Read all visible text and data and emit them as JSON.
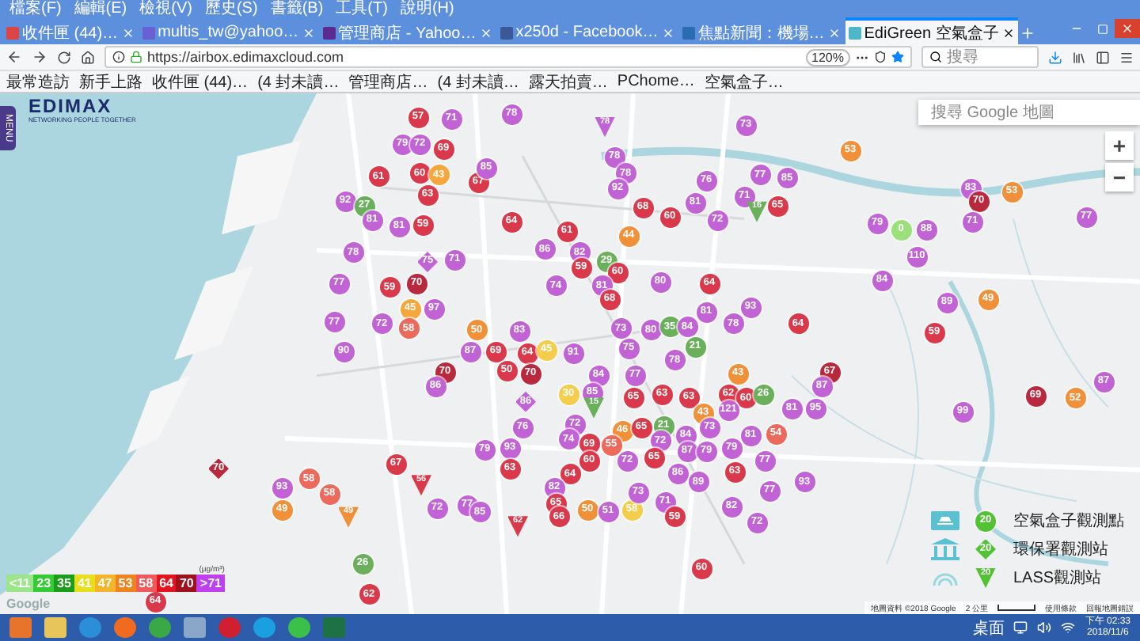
{
  "menu_bar": [
    "檔案(F)",
    "編輯(E)",
    "檢視(V)",
    "歷史(S)",
    "書籤(B)",
    "工具(T)",
    "說明(H)"
  ],
  "tabs": [
    {
      "title": "收件匣 (44)…",
      "selected": false
    },
    {
      "title": "multis_tw@yahoo…",
      "selected": false
    },
    {
      "title": "管理商店 - Yahoo…",
      "selected": false
    },
    {
      "title": "x250d - Facebook…",
      "selected": false
    },
    {
      "title": "焦點新聞：機場…",
      "selected": false
    },
    {
      "title": "EdiGreen 空氣盒子",
      "selected": true
    }
  ],
  "address_bar": {
    "url": "https://airbox.edimaxcloud.com",
    "zoom": "120%"
  },
  "search_bar": {
    "placeholder": "搜尋"
  },
  "bookmarks": [
    "最常造訪",
    "新手上路",
    "收件匣 (44)…",
    "(4 封未讀…",
    "管理商店…",
    "(4 封未讀…",
    "露天拍賣…",
    "PChome…",
    "空氣盒子…"
  ],
  "page": {
    "logo": "EDIMAX",
    "logo_tagline": "NETWORKING PEOPLE TOGETHER",
    "menu_button": "MENU",
    "map_search": {
      "placeholder": "搜尋 Google 地圖"
    },
    "zoom_in": "+",
    "zoom_out": "−"
  },
  "markers": [
    {
      "value": "57",
      "color": "#d9394a",
      "kind": "circle"
    },
    {
      "value": "71",
      "color": "#c163d4",
      "kind": "circle"
    },
    {
      "value": "78",
      "color": "#c163d4",
      "kind": "circle"
    },
    {
      "value": "79",
      "color": "#c163d4",
      "kind": "circle"
    },
    {
      "value": "72",
      "color": "#c163d4",
      "kind": "circle"
    },
    {
      "value": "69",
      "color": "#d9394a",
      "kind": "circle"
    },
    {
      "value": "61",
      "color": "#d9394a",
      "kind": "circle"
    },
    {
      "value": "60",
      "color": "#d9394a",
      "kind": "circle"
    },
    {
      "value": "43",
      "color": "#f5a73c",
      "kind": "circle"
    },
    {
      "value": "67",
      "color": "#d9394a",
      "kind": "circle"
    },
    {
      "value": "85",
      "color": "#c163d4",
      "kind": "circle"
    },
    {
      "value": "92",
      "color": "#c163d4",
      "kind": "circle"
    },
    {
      "value": "27",
      "color": "#6aaf5a",
      "kind": "circle"
    },
    {
      "value": "63",
      "color": "#d9394a",
      "kind": "circle"
    },
    {
      "value": "81",
      "color": "#c163d4",
      "kind": "circle"
    },
    {
      "value": "81",
      "color": "#c163d4",
      "kind": "circle"
    },
    {
      "value": "59",
      "color": "#d9394a",
      "kind": "circle"
    },
    {
      "value": "78",
      "color": "#c163d4",
      "kind": "circle"
    },
    {
      "value": "75",
      "color": "#c163d4",
      "kind": "diamond"
    },
    {
      "value": "71",
      "color": "#c163d4",
      "kind": "circle"
    },
    {
      "value": "77",
      "color": "#c163d4",
      "kind": "circle"
    },
    {
      "value": "59",
      "color": "#d9394a",
      "kind": "circle"
    },
    {
      "value": "70",
      "color": "#b8293d",
      "kind": "circle"
    },
    {
      "value": "45",
      "color": "#f5a73c",
      "kind": "circle"
    },
    {
      "value": "97",
      "color": "#c163d4",
      "kind": "circle"
    },
    {
      "value": "77",
      "color": "#c163d4",
      "kind": "circle"
    },
    {
      "value": "72",
      "color": "#c163d4",
      "kind": "circle"
    },
    {
      "value": "58",
      "color": "#ec6a5c",
      "kind": "circle"
    },
    {
      "value": "90",
      "color": "#c163d4",
      "kind": "circle"
    },
    {
      "value": "70",
      "color": "#b8293d",
      "kind": "circle"
    },
    {
      "value": "86",
      "color": "#c163d4",
      "kind": "circle"
    },
    {
      "value": "78",
      "color": "#c163d4",
      "kind": "triangle"
    },
    {
      "value": "73",
      "color": "#c163d4",
      "kind": "circle"
    },
    {
      "value": "78",
      "color": "#c163d4",
      "kind": "circle"
    },
    {
      "value": "78",
      "color": "#c163d4",
      "kind": "circle"
    },
    {
      "value": "92",
      "color": "#c163d4",
      "kind": "circle"
    },
    {
      "value": "76",
      "color": "#c163d4",
      "kind": "circle"
    },
    {
      "value": "77",
      "color": "#c163d4",
      "kind": "circle"
    },
    {
      "value": "85",
      "color": "#c163d4",
      "kind": "circle"
    },
    {
      "value": "68",
      "color": "#d9394a",
      "kind": "circle"
    },
    {
      "value": "60",
      "color": "#d9394a",
      "kind": "circle"
    },
    {
      "value": "81",
      "color": "#c163d4",
      "kind": "circle"
    },
    {
      "value": "72",
      "color": "#c163d4",
      "kind": "circle"
    },
    {
      "value": "71",
      "color": "#c163d4",
      "kind": "circle"
    },
    {
      "value": "16",
      "color": "#6aaf5a",
      "kind": "triangle"
    },
    {
      "value": "65",
      "color": "#d9394a",
      "kind": "circle"
    },
    {
      "value": "53",
      "color": "#f0913a",
      "kind": "circle"
    },
    {
      "value": "83",
      "color": "#c163d4",
      "kind": "circle"
    },
    {
      "value": "70",
      "color": "#b8293d",
      "kind": "circle"
    },
    {
      "value": "53",
      "color": "#f0913a",
      "kind": "circle"
    },
    {
      "value": "79",
      "color": "#c163d4",
      "kind": "circle"
    },
    {
      "value": "0",
      "color": "#9be07a",
      "kind": "circle"
    },
    {
      "value": "88",
      "color": "#c163d4",
      "kind": "circle"
    },
    {
      "value": "71",
      "color": "#c163d4",
      "kind": "circle"
    },
    {
      "value": "77",
      "color": "#c163d4",
      "kind": "circle"
    },
    {
      "value": "110",
      "color": "#c163d4",
      "kind": "circle"
    },
    {
      "value": "84",
      "color": "#c163d4",
      "kind": "circle"
    },
    {
      "value": "89",
      "color": "#c163d4",
      "kind": "circle"
    },
    {
      "value": "49",
      "color": "#f0913a",
      "kind": "circle"
    },
    {
      "value": "64",
      "color": "#d9394a",
      "kind": "circle"
    },
    {
      "value": "59",
      "color": "#d9394a",
      "kind": "circle"
    },
    {
      "value": "67",
      "color": "#b8293d",
      "kind": "circle"
    },
    {
      "value": "87",
      "color": "#c163d4",
      "kind": "circle"
    },
    {
      "value": "69",
      "color": "#b8293d",
      "kind": "circle"
    },
    {
      "value": "52",
      "color": "#f0913a",
      "kind": "circle"
    },
    {
      "value": "87",
      "color": "#c163d4",
      "kind": "circle"
    },
    {
      "value": "99",
      "color": "#c163d4",
      "kind": "circle"
    },
    {
      "value": "81",
      "color": "#c163d4",
      "kind": "circle"
    },
    {
      "value": "95",
      "color": "#c163d4",
      "kind": "circle"
    },
    {
      "value": "64",
      "color": "#d9394a",
      "kind": "circle"
    },
    {
      "value": "61",
      "color": "#d9394a",
      "kind": "circle"
    },
    {
      "value": "86",
      "color": "#c163d4",
      "kind": "circle"
    },
    {
      "value": "82",
      "color": "#c163d4",
      "kind": "circle"
    },
    {
      "value": "44",
      "color": "#f0913a",
      "kind": "circle"
    },
    {
      "value": "29",
      "color": "#6aaf5a",
      "kind": "circle"
    },
    {
      "value": "59",
      "color": "#d9394a",
      "kind": "circle"
    },
    {
      "value": "60",
      "color": "#d9394a",
      "kind": "circle"
    },
    {
      "value": "74",
      "color": "#c163d4",
      "kind": "circle"
    },
    {
      "value": "81",
      "color": "#c163d4",
      "kind": "circle"
    },
    {
      "value": "68",
      "color": "#d9394a",
      "kind": "circle"
    },
    {
      "value": "80",
      "color": "#c163d4",
      "kind": "circle"
    },
    {
      "value": "64",
      "color": "#d9394a",
      "kind": "circle"
    },
    {
      "value": "81",
      "color": "#c163d4",
      "kind": "circle"
    },
    {
      "value": "93",
      "color": "#c163d4",
      "kind": "circle"
    },
    {
      "value": "73",
      "color": "#c163d4",
      "kind": "circle"
    },
    {
      "value": "80",
      "color": "#c163d4",
      "kind": "circle"
    },
    {
      "value": "35",
      "color": "#6aaf5a",
      "kind": "circle"
    },
    {
      "value": "84",
      "color": "#c163d4",
      "kind": "circle"
    },
    {
      "value": "78",
      "color": "#c163d4",
      "kind": "circle"
    },
    {
      "value": "75",
      "color": "#c163d4",
      "kind": "circle"
    },
    {
      "value": "78",
      "color": "#c163d4",
      "kind": "circle"
    },
    {
      "value": "21",
      "color": "#6aaf5a",
      "kind": "circle"
    },
    {
      "value": "77",
      "color": "#c163d4",
      "kind": "circle"
    },
    {
      "value": "43",
      "color": "#f0913a",
      "kind": "circle"
    },
    {
      "value": "65",
      "color": "#d9394a",
      "kind": "circle"
    },
    {
      "value": "63",
      "color": "#d9394a",
      "kind": "circle"
    },
    {
      "value": "63",
      "color": "#d9394a",
      "kind": "circle"
    },
    {
      "value": "62",
      "color": "#d9394a",
      "kind": "circle"
    },
    {
      "value": "60",
      "color": "#d9394a",
      "kind": "circle"
    },
    {
      "value": "26",
      "color": "#6aaf5a",
      "kind": "circle"
    },
    {
      "value": "43",
      "color": "#f0913a",
      "kind": "circle"
    },
    {
      "value": "121",
      "color": "#c163d4",
      "kind": "circle"
    },
    {
      "value": "50",
      "color": "#f0913a",
      "kind": "circle"
    },
    {
      "value": "83",
      "color": "#c163d4",
      "kind": "circle"
    },
    {
      "value": "87",
      "color": "#c163d4",
      "kind": "circle"
    },
    {
      "value": "69",
      "color": "#d9394a",
      "kind": "circle"
    },
    {
      "value": "64",
      "color": "#d9394a",
      "kind": "circle"
    },
    {
      "value": "45",
      "color": "#f3cd4b",
      "kind": "circle"
    },
    {
      "value": "91",
      "color": "#c163d4",
      "kind": "circle"
    },
    {
      "value": "50",
      "color": "#d9394a",
      "kind": "circle"
    },
    {
      "value": "70",
      "color": "#b8293d",
      "kind": "circle"
    },
    {
      "value": "84",
      "color": "#c163d4",
      "kind": "circle"
    },
    {
      "value": "86",
      "color": "#c163d4",
      "kind": "diamond"
    },
    {
      "value": "30",
      "color": "#f3cd4b",
      "kind": "circle"
    },
    {
      "value": "85",
      "color": "#c163d4",
      "kind": "circle"
    },
    {
      "value": "15",
      "color": "#6aaf5a",
      "kind": "triangle"
    },
    {
      "value": "76",
      "color": "#c163d4",
      "kind": "circle"
    },
    {
      "value": "72",
      "color": "#c163d4",
      "kind": "circle"
    },
    {
      "value": "46",
      "color": "#f0913a",
      "kind": "circle"
    },
    {
      "value": "65",
      "color": "#d9394a",
      "kind": "circle"
    },
    {
      "value": "21",
      "color": "#6aaf5a",
      "kind": "circle"
    },
    {
      "value": "84",
      "color": "#c163d4",
      "kind": "circle"
    },
    {
      "value": "73",
      "color": "#c163d4",
      "kind": "circle"
    },
    {
      "value": "81",
      "color": "#c163d4",
      "kind": "circle"
    },
    {
      "value": "54",
      "color": "#ec6a5c",
      "kind": "circle"
    },
    {
      "value": "79",
      "color": "#c163d4",
      "kind": "circle"
    },
    {
      "value": "93",
      "color": "#c163d4",
      "kind": "circle"
    },
    {
      "value": "74",
      "color": "#c163d4",
      "kind": "circle"
    },
    {
      "value": "69",
      "color": "#d9394a",
      "kind": "circle"
    },
    {
      "value": "55",
      "color": "#ec6a5c",
      "kind": "circle"
    },
    {
      "value": "72",
      "color": "#c163d4",
      "kind": "circle"
    },
    {
      "value": "87",
      "color": "#c163d4",
      "kind": "circle"
    },
    {
      "value": "79",
      "color": "#c163d4",
      "kind": "circle"
    },
    {
      "value": "79",
      "color": "#c163d4",
      "kind": "circle"
    },
    {
      "value": "70",
      "color": "#b8293d",
      "kind": "diamond"
    },
    {
      "value": "67",
      "color": "#d9394a",
      "kind": "circle"
    },
    {
      "value": "63",
      "color": "#d9394a",
      "kind": "circle"
    },
    {
      "value": "64",
      "color": "#d9394a",
      "kind": "circle"
    },
    {
      "value": "60",
      "color": "#d9394a",
      "kind": "circle"
    },
    {
      "value": "72",
      "color": "#c163d4",
      "kind": "circle"
    },
    {
      "value": "65",
      "color": "#d9394a",
      "kind": "circle"
    },
    {
      "value": "86",
      "color": "#c163d4",
      "kind": "circle"
    },
    {
      "value": "89",
      "color": "#c163d4",
      "kind": "circle"
    },
    {
      "value": "63",
      "color": "#d9394a",
      "kind": "circle"
    },
    {
      "value": "77",
      "color": "#c163d4",
      "kind": "circle"
    },
    {
      "value": "93",
      "color": "#c163d4",
      "kind": "circle"
    },
    {
      "value": "58",
      "color": "#ec6a5c",
      "kind": "circle"
    },
    {
      "value": "58",
      "color": "#ec6a5c",
      "kind": "circle"
    },
    {
      "value": "56",
      "color": "#d9394a",
      "kind": "triangle"
    },
    {
      "value": "49",
      "color": "#f0913a",
      "kind": "circle"
    },
    {
      "value": "49",
      "color": "#f0913a",
      "kind": "triangle"
    },
    {
      "value": "72",
      "color": "#c163d4",
      "kind": "circle"
    },
    {
      "value": "77",
      "color": "#c163d4",
      "kind": "circle"
    },
    {
      "value": "85",
      "color": "#c163d4",
      "kind": "circle"
    },
    {
      "value": "62",
      "color": "#d9394a",
      "kind": "triangle"
    },
    {
      "value": "82",
      "color": "#c163d4",
      "kind": "circle"
    },
    {
      "value": "65",
      "color": "#d9394a",
      "kind": "circle"
    },
    {
      "value": "66",
      "color": "#d9394a",
      "kind": "circle"
    },
    {
      "value": "50",
      "color": "#f0913a",
      "kind": "circle"
    },
    {
      "value": "51",
      "color": "#c163d4",
      "kind": "circle"
    },
    {
      "value": "58",
      "color": "#f3cd4b",
      "kind": "circle"
    },
    {
      "value": "73",
      "color": "#c163d4",
      "kind": "circle"
    },
    {
      "value": "71",
      "color": "#c163d4",
      "kind": "circle"
    },
    {
      "value": "59",
      "color": "#d9394a",
      "kind": "circle"
    },
    {
      "value": "82",
      "color": "#c163d4",
      "kind": "circle"
    },
    {
      "value": "72",
      "color": "#c163d4",
      "kind": "circle"
    },
    {
      "value": "77",
      "color": "#c163d4",
      "kind": "circle"
    },
    {
      "value": "93",
      "color": "#c163d4",
      "kind": "circle"
    },
    {
      "value": "26",
      "color": "#6aaf5a",
      "kind": "circle"
    },
    {
      "value": "60",
      "color": "#d9394a",
      "kind": "circle"
    },
    {
      "value": "64",
      "color": "#d9394a",
      "kind": "circle"
    },
    {
      "value": "62",
      "color": "#d9394a",
      "kind": "circle"
    }
  ],
  "aqi_legend": {
    "unit": "(μg/m³)",
    "steps": [
      {
        "label": "<11",
        "color": "#9be58a"
      },
      {
        "label": "23",
        "color": "#33cc33"
      },
      {
        "label": "35",
        "color": "#1a9e1a"
      },
      {
        "label": "41",
        "color": "#eadd1c"
      },
      {
        "label": "47",
        "color": "#f5b52a"
      },
      {
        "label": "53",
        "color": "#f0841c"
      },
      {
        "label": "58",
        "color": "#f05a5a"
      },
      {
        "label": "64",
        "color": "#e4141e"
      },
      {
        "label": "70",
        "color": "#a0101c"
      },
      {
        "label": ">71",
        "color": "#c040f0"
      }
    ]
  },
  "google_logo": "Google",
  "source_legend": [
    {
      "label": "空氣盒子觀測點",
      "marker": "20",
      "kind": "circle"
    },
    {
      "label": "環保署觀測站",
      "marker": "20",
      "kind": "diamond"
    },
    {
      "label": "LASS觀測站",
      "marker": "20",
      "kind": "triangle"
    }
  ],
  "map_footer": [
    "地圖資料 ©2018 Google",
    "2 公里",
    "使用條款",
    "回報地圖錯誤"
  ],
  "taskbar": {
    "tray_label": "桌面",
    "time": "下午 02:33",
    "date": "2018/11/6"
  }
}
